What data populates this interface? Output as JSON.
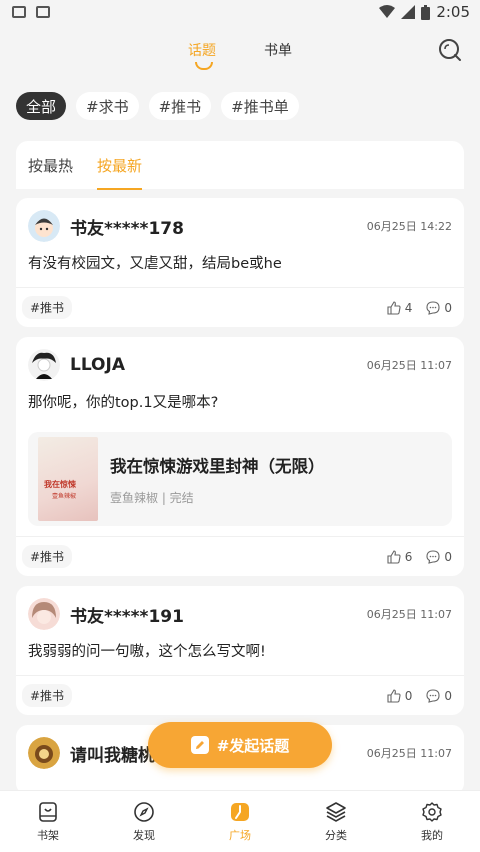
{
  "status": {
    "time": "2:05"
  },
  "header": {
    "tabs": [
      {
        "label": "话题"
      },
      {
        "label": "书单"
      }
    ]
  },
  "tag_filters": [
    "全部",
    "#求书",
    "#推书",
    "#推书单"
  ],
  "sort": {
    "hot": "按最热",
    "new": "按最新"
  },
  "posts": [
    {
      "author": "书友*****178",
      "time": "06月25日 14:22",
      "content": "有没有校园文，又虐又甜，结局be或he",
      "tag": "#推书",
      "likes": "4",
      "comments": "0"
    },
    {
      "author": "LLOJA",
      "time": "06月25日 11:07",
      "content": "那你呢，你的top.1又是哪本?",
      "tag": "#推书",
      "likes": "6",
      "comments": "0",
      "book": {
        "title": "我在惊悚游戏里封神（无限）",
        "meta": "壹鱼辣椒 | 完结",
        "cover_text": "我在惊悚",
        "cover_sub": "壹鱼辣椒"
      }
    },
    {
      "author": "书友*****191",
      "time": "06月25日 11:07",
      "content": "我弱弱的问一句嗷，这个怎么写文啊!",
      "tag": "#推书",
      "likes": "0",
      "comments": "0"
    },
    {
      "author": "请叫我糖桃",
      "time": "06月25日 11:07",
      "content": ""
    }
  ],
  "fab": {
    "label": "#发起话题"
  },
  "bottom_nav": [
    {
      "label": "书架"
    },
    {
      "label": "发现"
    },
    {
      "label": "广场"
    },
    {
      "label": "分类"
    },
    {
      "label": "我的"
    }
  ],
  "colors": {
    "accent": "#f5a623",
    "background": "#f4f4f4"
  }
}
